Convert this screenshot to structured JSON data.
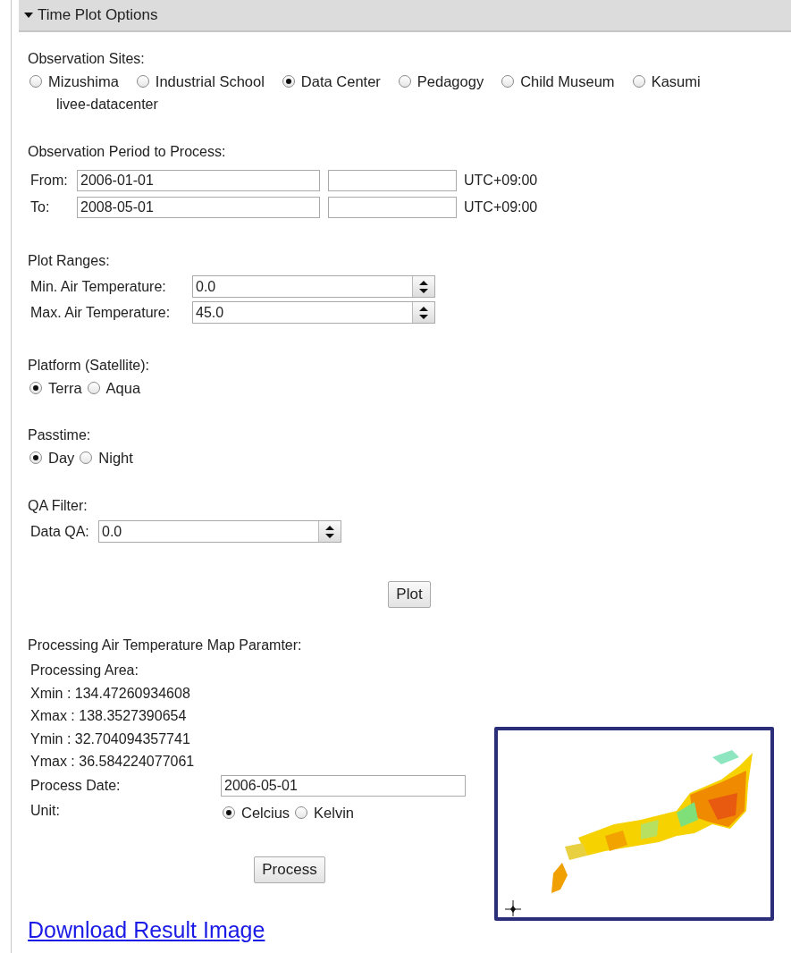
{
  "panel": {
    "title": "Time Plot Options",
    "expanded": true
  },
  "observation_sites": {
    "label": "Observation Sites:",
    "site_id": "livee-datacenter",
    "options": [
      {
        "label": "Mizushima",
        "selected": false
      },
      {
        "label": "Industrial School",
        "selected": false
      },
      {
        "label": "Data Center",
        "selected": true
      },
      {
        "label": "Pedagogy",
        "selected": false
      },
      {
        "label": "Child Museum",
        "selected": false
      },
      {
        "label": "Kasumi",
        "selected": false
      }
    ]
  },
  "period": {
    "label": "Observation Period to Process:",
    "rows": [
      {
        "label": "From:",
        "date": "2006-01-01",
        "timezone": "UTC+09:00"
      },
      {
        "label": "To:",
        "date": "2008-05-01",
        "timezone": "UTC+09:00"
      }
    ]
  },
  "plot_ranges": {
    "label": "Plot Ranges:",
    "fields": [
      {
        "label": "Min. Air Temperature:",
        "value": "0.0"
      },
      {
        "label": "Max. Air Temperature:",
        "value": "45.0"
      }
    ]
  },
  "platform": {
    "label": "Platform (Satellite):",
    "options": [
      {
        "label": "Terra",
        "selected": true
      },
      {
        "label": "Aqua",
        "selected": false
      }
    ]
  },
  "passtime": {
    "label": "Passtime:",
    "options": [
      {
        "label": "Day",
        "selected": true
      },
      {
        "label": "Night",
        "selected": false
      }
    ]
  },
  "qa_filter": {
    "label": "QA Filter:",
    "fields": [
      {
        "label": "Data QA:",
        "value": "0.0"
      }
    ]
  },
  "plot_button": "Plot",
  "processing": {
    "label": "Processing Air Temperature Map Paramter:",
    "area_label": "Processing Area:",
    "bounds": [
      "Xmin : 134.47260934608",
      "Xmax : 138.3527390654",
      "Ymin : 32.704094357741",
      "Ymax : 36.584224077061"
    ],
    "date_label": "Process Date:",
    "date": "2006-05-01",
    "unit_label": "Unit:",
    "units": [
      {
        "label": "Celcius",
        "selected": true
      },
      {
        "label": "Kelvin",
        "selected": false
      }
    ],
    "button": "Process"
  },
  "download_link": "Download Result Image"
}
